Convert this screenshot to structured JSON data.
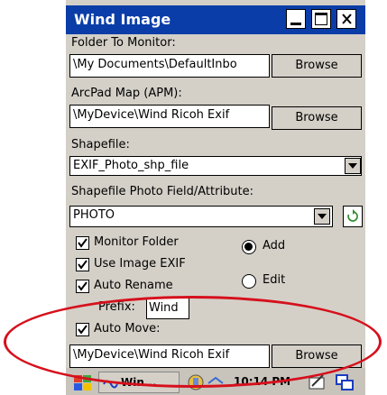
{
  "window": {
    "title": "Wind Image",
    "controls": [
      "minimize",
      "maximize",
      "close"
    ]
  },
  "folder_to_monitor": {
    "label": "Folder To Monitor:",
    "value": "\\My Documents\\DefaultInbo",
    "button": "Browse"
  },
  "arcpad_map": {
    "label": "ArcPad Map (APM):",
    "value": "\\MyDevice\\Wind Ricoh Exif",
    "button": "Browse"
  },
  "shapefile": {
    "label": "Shapefile:",
    "value": "EXIF_Photo_shp_file"
  },
  "photo_field": {
    "label": "Shapefile Photo Field/Attribute:",
    "value": "PHOTO"
  },
  "options": {
    "monitor_folder": {
      "label": "Monitor Folder",
      "checked": true
    },
    "use_image_exif": {
      "label": "Use Image EXIF",
      "checked": true
    },
    "auto_rename": {
      "label": "Auto Rename",
      "checked": true
    },
    "prefix_label": "Prefix:",
    "prefix_value": "Wind",
    "auto_move": {
      "label": "Auto Move:",
      "checked": true
    }
  },
  "mode": {
    "add_label": "Add",
    "edit_label": "Edit",
    "selected": "Add"
  },
  "move_destination": {
    "value": "\\MyDevice\\Wind Ricoh Exif",
    "button": "Browse"
  },
  "taskbar": {
    "app_label": "Win...",
    "time": "10:14 PM"
  },
  "colors": {
    "titlebar": "#0a3da8",
    "dialog_bg": "#d4d0c8",
    "annotation": "#d6101c"
  }
}
